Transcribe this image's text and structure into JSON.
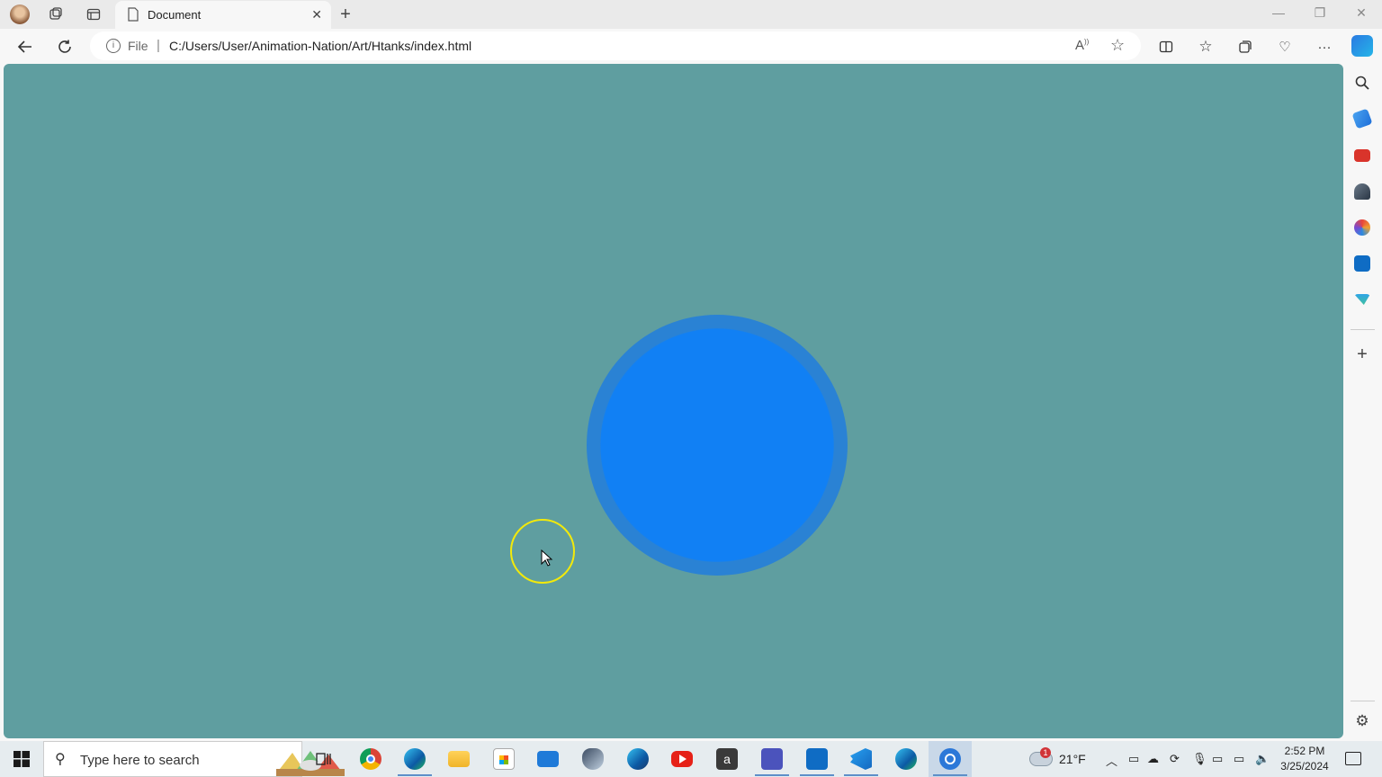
{
  "browser": {
    "tab_title": "Document",
    "address_scheme_label": "File",
    "address_separator": "|",
    "url": "C:/Users/User/Animation-Nation/Art/Htanks/index.html"
  },
  "page": {
    "background_color": "#5f9ea0",
    "circle_color": "#1180f4",
    "cursor_highlight_color": "#f2e90b"
  },
  "taskbar": {
    "search_placeholder": "Type here to search",
    "weather_temp": "21°F",
    "weather_badge": "1",
    "time": "2:52 PM",
    "date": "3/25/2024"
  },
  "icons": [
    "profile-avatar-icon",
    "workspaces-icon",
    "tab-actions-icon",
    "page-icon",
    "close-icon",
    "new-tab-icon",
    "minimize-icon",
    "restore-icon",
    "back-icon",
    "refresh-icon",
    "info-icon",
    "read-aloud-icon",
    "favorite-star-icon",
    "split-screen-icon",
    "favorites-icon",
    "collections-icon",
    "browser-essentials-icon",
    "more-icon",
    "copilot-icon",
    "search-icon",
    "shopping-icon",
    "tools-icon",
    "games-icon",
    "office-icon",
    "outlook-icon",
    "drop-icon",
    "add-icon",
    "settings-icon",
    "windows-start-icon",
    "task-view-icon",
    "chrome-icon",
    "edge-icon",
    "file-explorer-icon",
    "store-icon",
    "mail-icon",
    "vpn-icon",
    "edge-dev-icon",
    "youtube-icon",
    "amazon-icon",
    "teams-icon",
    "outlook-taskbar-icon",
    "vscode-icon",
    "edge-beta-icon",
    "active-app-icon",
    "weather-icon",
    "notifications-icon"
  ]
}
